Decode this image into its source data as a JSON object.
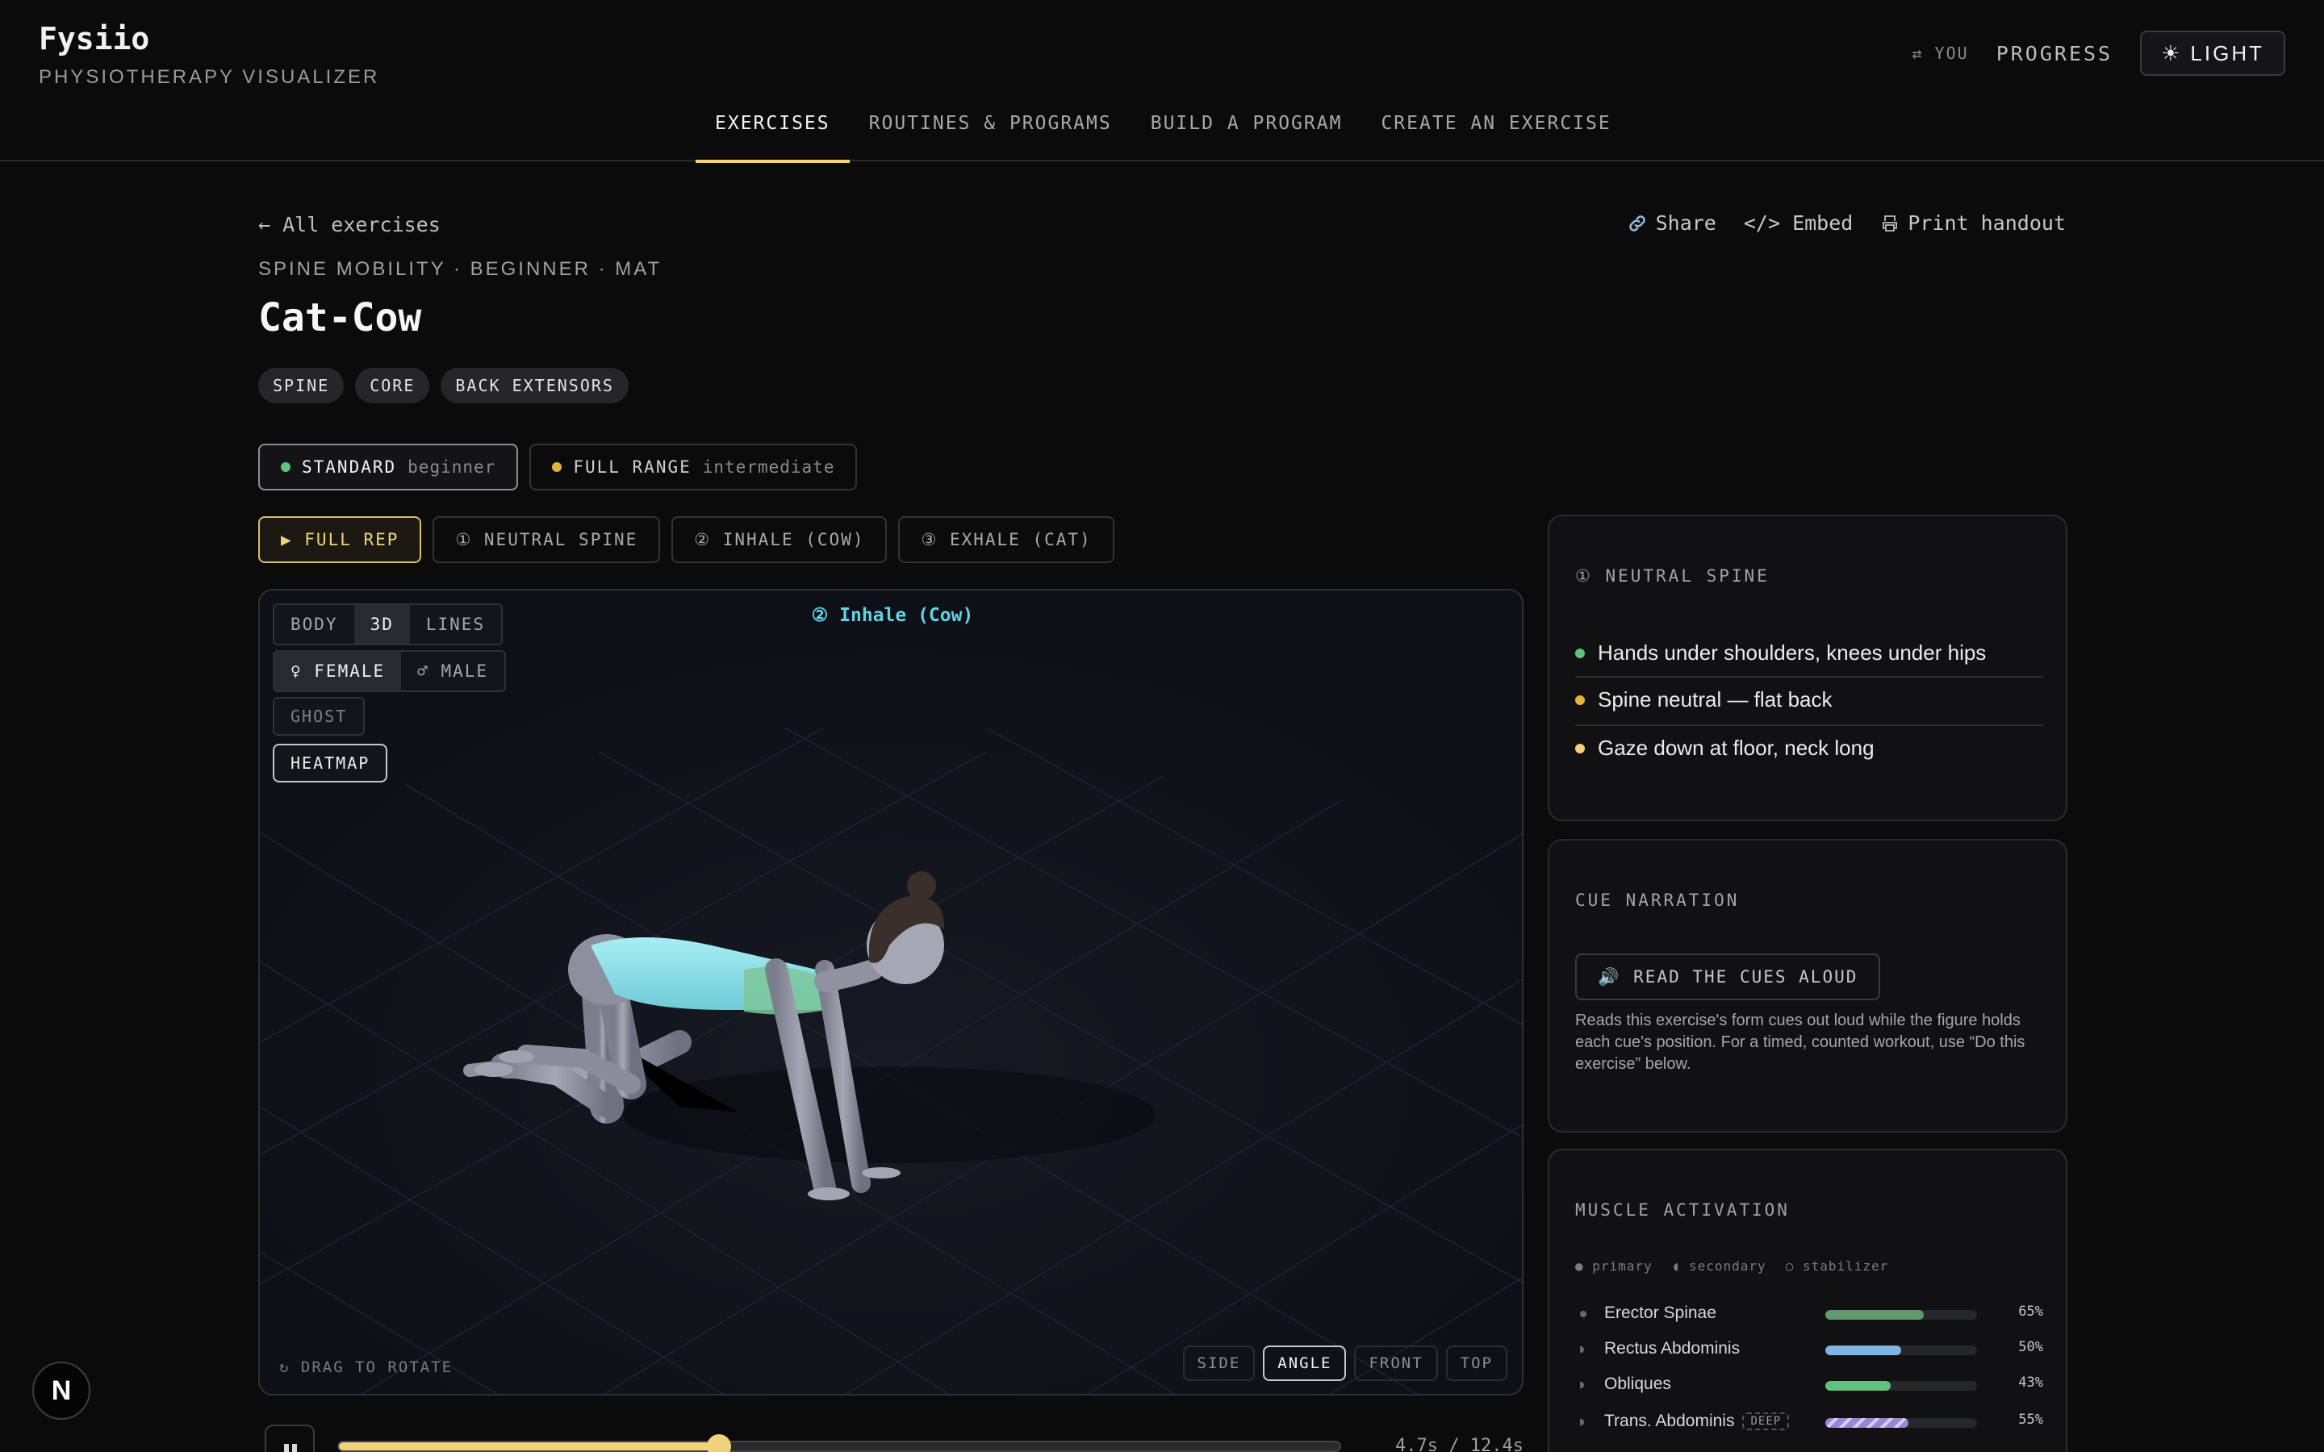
{
  "header": {
    "brand": "Fysiio",
    "subtitle": "PHYSIOTHERAPY VISUALIZER",
    "user_label": "⇄ YOU",
    "progress_label": "PROGRESS",
    "theme_label": "LIGHT",
    "theme_icon": "☀"
  },
  "nav": {
    "items": [
      "EXERCISES",
      "ROUTINES & PROGRAMS",
      "BUILD A PROGRAM",
      "CREATE AN EXERCISE"
    ],
    "active": "EXERCISES"
  },
  "page": {
    "back_label": "← All exercises",
    "share_label": "Share",
    "embed_label": "</> Embed",
    "print_label": "Print handout",
    "meta": "SPINE MOBILITY · BEGINNER · MAT",
    "title": "Cat-Cow",
    "tags": [
      "SPINE",
      "CORE",
      "BACK EXTENSORS"
    ]
  },
  "variants": [
    {
      "name": "STANDARD",
      "level": "beginner",
      "color": "#5fc37a",
      "active": true
    },
    {
      "name": "FULL RANGE",
      "level": "intermediate",
      "color": "#e2b43b",
      "active": false
    }
  ],
  "phases": [
    "▶ FULL REP",
    "① NEUTRAL SPINE",
    "② INHALE (COW)",
    "③ EXHALE (CAT)"
  ],
  "viewer": {
    "mode_buttons": [
      "BODY",
      "3D",
      "LINES"
    ],
    "mode_active": "3D",
    "gender_buttons": [
      "♀ FEMALE",
      "♂ MALE"
    ],
    "gender_active": "♀ FEMALE",
    "ghost_label": "GHOST",
    "heatmap_label": "HEATMAP",
    "phase_label": "② Inhale (Cow)",
    "drag_label": "↻ DRAG TO ROTATE",
    "views": [
      "SIDE",
      "ANGLE",
      "FRONT",
      "TOP"
    ],
    "view_active": "ANGLE"
  },
  "playback": {
    "progress": 0.38,
    "time_label": "4.7s / 12.4s"
  },
  "cues_panel": {
    "title": "① NEUTRAL SPINE",
    "cues": [
      {
        "text": "Hands under shoulders, knees under hips",
        "color": "#5fc37a"
      },
      {
        "text": "Spine neutral — flat back",
        "color": "#e2b43b"
      },
      {
        "text": "Gaze down at floor, neck long",
        "color": "#f0d27a"
      }
    ]
  },
  "narration_panel": {
    "title": "CUE NARRATION",
    "button_label": "READ THE CUES ALOUD",
    "description": "Reads this exercise's form cues out loud while the figure holds each cue's position. For a timed, counted workout, use “Do this exercise” below."
  },
  "muscle_panel": {
    "title": "MUSCLE ACTIVATION",
    "legend": [
      "● primary",
      "◖ secondary",
      "○ stabilizer"
    ],
    "muscles": [
      {
        "name": "Erector Spinae",
        "pct_label": "65%",
        "value": 0.65,
        "color": "#5e9a6c",
        "tag": ""
      },
      {
        "name": "Rectus Abdominis",
        "pct_label": "50%",
        "value": 0.5,
        "color": "#7fb6e4",
        "tag": ""
      },
      {
        "name": "Obliques",
        "pct_label": "43%",
        "value": 0.43,
        "color": "#62c27c",
        "tag": ""
      },
      {
        "name": "Trans. Abdominis",
        "pct_label": "55%",
        "value": 0.55,
        "color": "#9b86d6",
        "tag": "DEEP"
      }
    ]
  },
  "badge": "N"
}
